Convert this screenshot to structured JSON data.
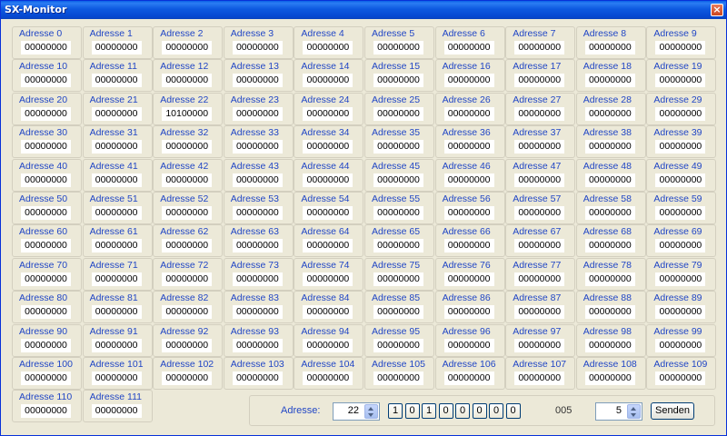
{
  "window": {
    "title": "SX-Monitor"
  },
  "addresses": [
    {
      "label": "Adresse 0",
      "value": "00000000"
    },
    {
      "label": "Adresse 1",
      "value": "00000000"
    },
    {
      "label": "Adresse 2",
      "value": "00000000"
    },
    {
      "label": "Adresse 3",
      "value": "00000000"
    },
    {
      "label": "Adresse 4",
      "value": "00000000"
    },
    {
      "label": "Adresse 5",
      "value": "00000000"
    },
    {
      "label": "Adresse 6",
      "value": "00000000"
    },
    {
      "label": "Adresse 7",
      "value": "00000000"
    },
    {
      "label": "Adresse 8",
      "value": "00000000"
    },
    {
      "label": "Adresse 9",
      "value": "00000000"
    },
    {
      "label": "Adresse 10",
      "value": "00000000"
    },
    {
      "label": "Adresse 11",
      "value": "00000000"
    },
    {
      "label": "Adresse 12",
      "value": "00000000"
    },
    {
      "label": "Adresse 13",
      "value": "00000000"
    },
    {
      "label": "Adresse 14",
      "value": "00000000"
    },
    {
      "label": "Adresse 15",
      "value": "00000000"
    },
    {
      "label": "Adresse 16",
      "value": "00000000"
    },
    {
      "label": "Adresse 17",
      "value": "00000000"
    },
    {
      "label": "Adresse 18",
      "value": "00000000"
    },
    {
      "label": "Adresse 19",
      "value": "00000000"
    },
    {
      "label": "Adresse 20",
      "value": "00000000"
    },
    {
      "label": "Adresse 21",
      "value": "00000000"
    },
    {
      "label": "Adresse 22",
      "value": "10100000"
    },
    {
      "label": "Adresse 23",
      "value": "00000000"
    },
    {
      "label": "Adresse 24",
      "value": "00000000"
    },
    {
      "label": "Adresse 25",
      "value": "00000000"
    },
    {
      "label": "Adresse 26",
      "value": "00000000"
    },
    {
      "label": "Adresse 27",
      "value": "00000000"
    },
    {
      "label": "Adresse 28",
      "value": "00000000"
    },
    {
      "label": "Adresse 29",
      "value": "00000000"
    },
    {
      "label": "Adresse 30",
      "value": "00000000"
    },
    {
      "label": "Adresse 31",
      "value": "00000000"
    },
    {
      "label": "Adresse 32",
      "value": "00000000"
    },
    {
      "label": "Adresse 33",
      "value": "00000000"
    },
    {
      "label": "Adresse 34",
      "value": "00000000"
    },
    {
      "label": "Adresse 35",
      "value": "00000000"
    },
    {
      "label": "Adresse 36",
      "value": "00000000"
    },
    {
      "label": "Adresse 37",
      "value": "00000000"
    },
    {
      "label": "Adresse 38",
      "value": "00000000"
    },
    {
      "label": "Adresse 39",
      "value": "00000000"
    },
    {
      "label": "Adresse 40",
      "value": "00000000"
    },
    {
      "label": "Adresse 41",
      "value": "00000000"
    },
    {
      "label": "Adresse 42",
      "value": "00000000"
    },
    {
      "label": "Adresse 43",
      "value": "00000000"
    },
    {
      "label": "Adresse 44",
      "value": "00000000"
    },
    {
      "label": "Adresse 45",
      "value": "00000000"
    },
    {
      "label": "Adresse 46",
      "value": "00000000"
    },
    {
      "label": "Adresse 47",
      "value": "00000000"
    },
    {
      "label": "Adresse 48",
      "value": "00000000"
    },
    {
      "label": "Adresse 49",
      "value": "00000000"
    },
    {
      "label": "Adresse 50",
      "value": "00000000"
    },
    {
      "label": "Adresse 51",
      "value": "00000000"
    },
    {
      "label": "Adresse 52",
      "value": "00000000"
    },
    {
      "label": "Adresse 53",
      "value": "00000000"
    },
    {
      "label": "Adresse 54",
      "value": "00000000"
    },
    {
      "label": "Adresse 55",
      "value": "00000000"
    },
    {
      "label": "Adresse 56",
      "value": "00000000"
    },
    {
      "label": "Adresse 57",
      "value": "00000000"
    },
    {
      "label": "Adresse 58",
      "value": "00000000"
    },
    {
      "label": "Adresse 59",
      "value": "00000000"
    },
    {
      "label": "Adresse 60",
      "value": "00000000"
    },
    {
      "label": "Adresse 61",
      "value": "00000000"
    },
    {
      "label": "Adresse 62",
      "value": "00000000"
    },
    {
      "label": "Adresse 63",
      "value": "00000000"
    },
    {
      "label": "Adresse 64",
      "value": "00000000"
    },
    {
      "label": "Adresse 65",
      "value": "00000000"
    },
    {
      "label": "Adresse 66",
      "value": "00000000"
    },
    {
      "label": "Adresse 67",
      "value": "00000000"
    },
    {
      "label": "Adresse 68",
      "value": "00000000"
    },
    {
      "label": "Adresse 69",
      "value": "00000000"
    },
    {
      "label": "Adresse 70",
      "value": "00000000"
    },
    {
      "label": "Adresse 71",
      "value": "00000000"
    },
    {
      "label": "Adresse 72",
      "value": "00000000"
    },
    {
      "label": "Adresse 73",
      "value": "00000000"
    },
    {
      "label": "Adresse 74",
      "value": "00000000"
    },
    {
      "label": "Adresse 75",
      "value": "00000000"
    },
    {
      "label": "Adresse 76",
      "value": "00000000"
    },
    {
      "label": "Adresse 77",
      "value": "00000000"
    },
    {
      "label": "Adresse 78",
      "value": "00000000"
    },
    {
      "label": "Adresse 79",
      "value": "00000000"
    },
    {
      "label": "Adresse 80",
      "value": "00000000"
    },
    {
      "label": "Adresse 81",
      "value": "00000000"
    },
    {
      "label": "Adresse 82",
      "value": "00000000"
    },
    {
      "label": "Adresse 83",
      "value": "00000000"
    },
    {
      "label": "Adresse 84",
      "value": "00000000"
    },
    {
      "label": "Adresse 85",
      "value": "00000000"
    },
    {
      "label": "Adresse 86",
      "value": "00000000"
    },
    {
      "label": "Adresse 87",
      "value": "00000000"
    },
    {
      "label": "Adresse 88",
      "value": "00000000"
    },
    {
      "label": "Adresse 89",
      "value": "00000000"
    },
    {
      "label": "Adresse 90",
      "value": "00000000"
    },
    {
      "label": "Adresse 91",
      "value": "00000000"
    },
    {
      "label": "Adresse 92",
      "value": "00000000"
    },
    {
      "label": "Adresse 93",
      "value": "00000000"
    },
    {
      "label": "Adresse 94",
      "value": "00000000"
    },
    {
      "label": "Adresse 95",
      "value": "00000000"
    },
    {
      "label": "Adresse 96",
      "value": "00000000"
    },
    {
      "label": "Adresse 97",
      "value": "00000000"
    },
    {
      "label": "Adresse 98",
      "value": "00000000"
    },
    {
      "label": "Adresse 99",
      "value": "00000000"
    },
    {
      "label": "Adresse 100",
      "value": "00000000"
    },
    {
      "label": "Adresse 101",
      "value": "00000000"
    },
    {
      "label": "Adresse 102",
      "value": "00000000"
    },
    {
      "label": "Adresse 103",
      "value": "00000000"
    },
    {
      "label": "Adresse 104",
      "value": "00000000"
    },
    {
      "label": "Adresse 105",
      "value": "00000000"
    },
    {
      "label": "Adresse 106",
      "value": "00000000"
    },
    {
      "label": "Adresse 107",
      "value": "00000000"
    },
    {
      "label": "Adresse 108",
      "value": "00000000"
    },
    {
      "label": "Adresse 109",
      "value": "00000000"
    },
    {
      "label": "Adresse 110",
      "value": "00000000"
    },
    {
      "label": "Adresse 111",
      "value": "00000000"
    }
  ],
  "control": {
    "address_label": "Adresse:",
    "address_value": "22",
    "bits": [
      "1",
      "0",
      "1",
      "0",
      "0",
      "0",
      "0",
      "0"
    ],
    "hex_value": "005",
    "send_value": "5",
    "send_label": "Senden"
  }
}
